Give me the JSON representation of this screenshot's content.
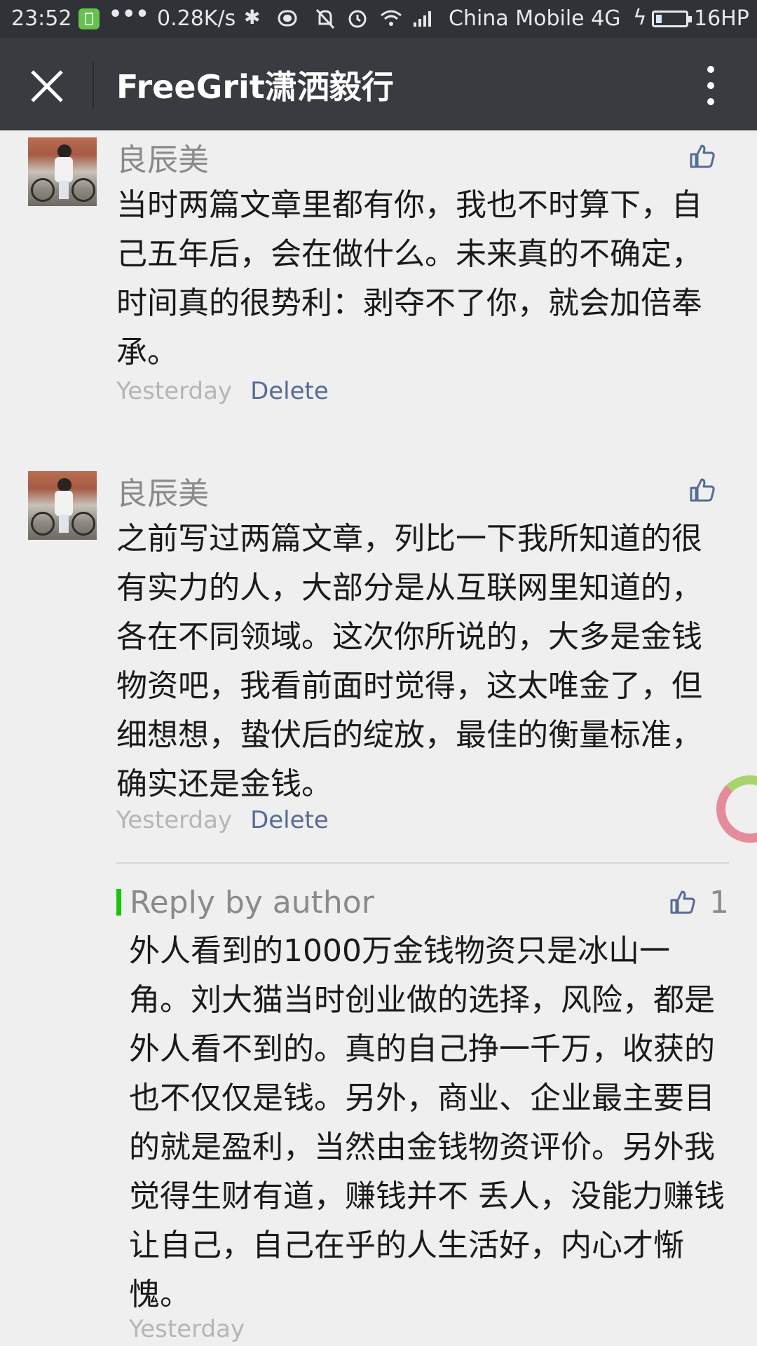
{
  "status_bar": {
    "time": "23:52",
    "dots": "•••",
    "speed": "0.28K/s",
    "carrier": "China Mobile 4G",
    "battery_label": "16HP"
  },
  "header": {
    "title": "FreeGrit潇洒毅行"
  },
  "comments": [
    {
      "author": "良辰美",
      "text": "当时两篇文章里都有你，我也不时算下，自己五年后，会在做什么。未来真的不确定，时间真的很势利：剥夺不了你，就会加倍奉承。",
      "time": "Yesterday",
      "delete_label": "Delete"
    },
    {
      "author": "良辰美",
      "text": "之前写过两篇文章，列比一下我所知道的很有实力的人，大部分是从互联网里知道的，各在不同领域。这次你所说的，大多是金钱物资吧，我看前面时觉得，这太唯金了，但细想想，蛰伏后的绽放，最佳的衡量标准，确实还是金钱。",
      "time": "Yesterday",
      "delete_label": "Delete",
      "reply": {
        "label": "Reply by author",
        "likes": "1",
        "text": "外人看到的1000万金钱物资只是冰山一角。刘大猫当时创业做的选择，风险，都是外人看不到的。真的自己挣一千万，收获的也不仅仅是钱。另外，商业、企业最主要目的就是盈利，当然由金钱物资评价。另外我觉得生财有道，赚钱并不 丢人，没能力赚钱让自己，自己在乎的人生活好，内心才惭愧。",
        "time": "Yesterday"
      }
    }
  ],
  "colors": {
    "link": "#576b95",
    "reply_bar": "#16c60c",
    "titlebar": "#383b3f"
  }
}
